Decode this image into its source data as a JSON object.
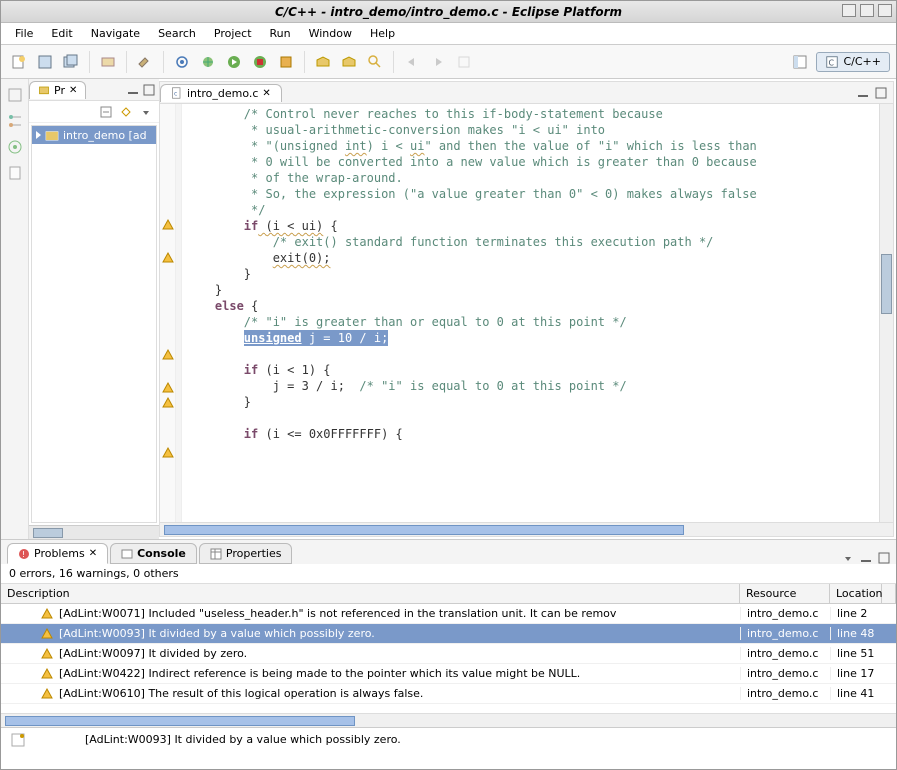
{
  "window_title": "C/C++ - intro_demo/intro_demo.c - Eclipse Platform",
  "menu": [
    "File",
    "Edit",
    "Navigate",
    "Search",
    "Project",
    "Run",
    "Window",
    "Help"
  ],
  "perspective": "C/C++",
  "project_pane": {
    "tab": "Pr",
    "item": "intro_demo [ad"
  },
  "editor": {
    "tab": "intro_demo.c",
    "code_lines": [
      "        /* Control never reaches to this if-body-statement because",
      "         * usual-arithmetic-conversion makes \"i < ui\" into",
      "         * \"(unsigned int) i < ui\" and then the value of \"i\" which is less than",
      "         * 0 will be converted into a new value which is greater than 0 because",
      "         * of the wrap-around.",
      "         * So, the expression (\"a value greater than 0\" < 0) makes always false",
      "         */"
    ],
    "if_line_kw": "if",
    "if_line_rest": " (i < ui) {",
    "exit_cmt": "/* exit() standard function terminates this execution path */",
    "exit_call": "exit(0);",
    "close1": "        }",
    "close2": "    }",
    "else_kw": "else",
    "else_rest": " {",
    "else_cmt": "/* \"i\" is greater than or equal to 0 at this point */",
    "hl_kw": "unsigned",
    "hl_rest": " j = 10 / i;",
    "if2_kw": "if",
    "if2_rest": " (i < 1) {",
    "j_assign": "            j = 3 / i;  ",
    "j_cmt": "/* \"i\" is equal to 0 at this point */",
    "close3": "        }",
    "if3_kw": "if",
    "if3_rest": " (i <= 0x0FFFFFFF) {"
  },
  "problems": {
    "tabs": [
      "Problems",
      "Console",
      "Properties"
    ],
    "summary": "0 errors, 16 warnings, 0 others",
    "columns": [
      "Description",
      "Resource",
      "Location"
    ],
    "rows": [
      {
        "desc": "[AdLint:W0071] Included \"useless_header.h\" is not referenced in the translation unit. It can be remov",
        "res": "intro_demo.c",
        "loc": "line 2",
        "sel": false
      },
      {
        "desc": "[AdLint:W0093] It divided by a value which possibly zero.",
        "res": "intro_demo.c",
        "loc": "line 48",
        "sel": true
      },
      {
        "desc": "[AdLint:W0097] It divided by zero.",
        "res": "intro_demo.c",
        "loc": "line 51",
        "sel": false
      },
      {
        "desc": "[AdLint:W0422] Indirect reference is being made to the pointer which its value might be NULL.",
        "res": "intro_demo.c",
        "loc": "line 17",
        "sel": false
      },
      {
        "desc": "[AdLint:W0610] The result of this logical operation is always false.",
        "res": "intro_demo.c",
        "loc": "line 41",
        "sel": false
      }
    ]
  },
  "status": "[AdLint:W0093] It divided by a value which possibly zero."
}
